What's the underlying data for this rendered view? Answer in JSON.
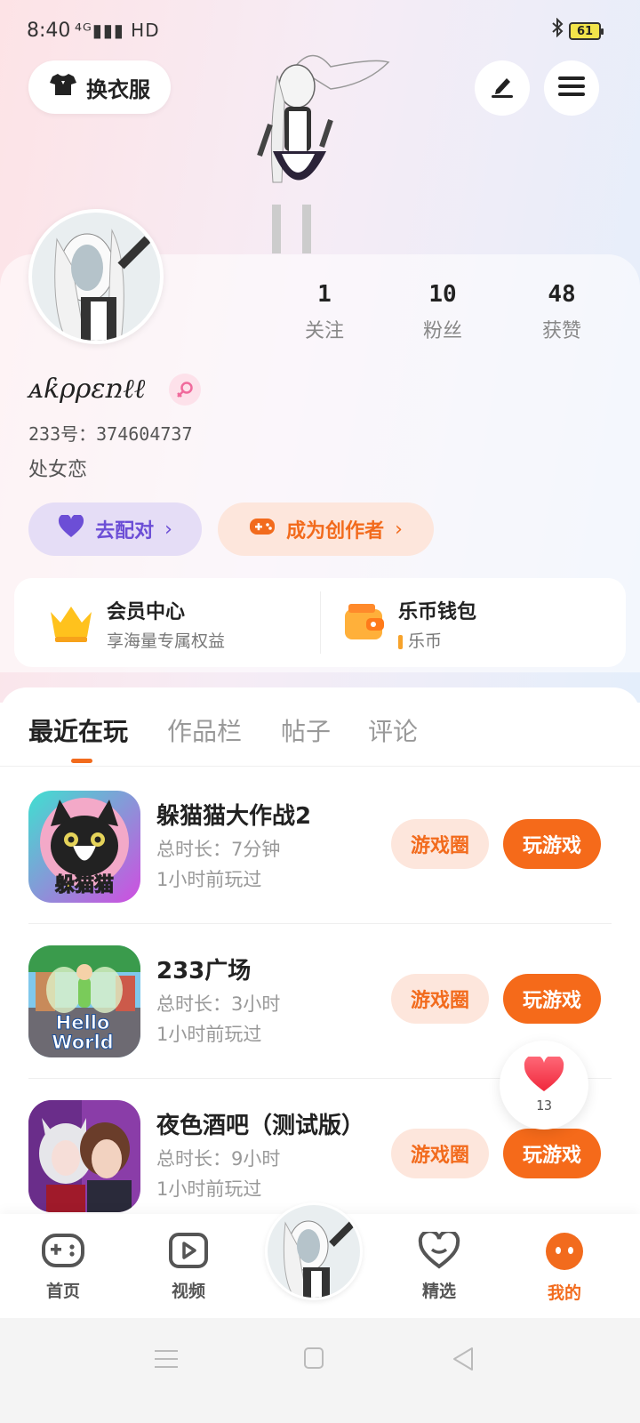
{
  "status_bar": {
    "time": "8:40",
    "network": "⁴ᴳ▮▮▮ HD",
    "battery": "61"
  },
  "header": {
    "outfit_label": "换衣服"
  },
  "profile": {
    "stats": [
      {
        "value": "1",
        "label": "关注"
      },
      {
        "value": "10",
        "label": "粉丝"
      },
      {
        "value": "48",
        "label": "获赞"
      }
    ],
    "nickname": "ᴀƙρρεռℓℓ",
    "user_id": "233号：374604737",
    "bio": "处女恋",
    "match_label": "去配对",
    "creator_label": "成为创作者"
  },
  "member": {
    "title": "会员中心",
    "subtitle": "享海量专属权益"
  },
  "wallet": {
    "title": "乐币钱包",
    "subtitle": "乐币"
  },
  "tabs": [
    {
      "label": "最近在玩"
    },
    {
      "label": "作品栏"
    },
    {
      "label": "帖子"
    },
    {
      "label": "评论"
    }
  ],
  "games": [
    {
      "title": "躲猫猫大作战2",
      "duration": "总时长：7分钟",
      "last_played": "1小时前玩过",
      "icon_text": "躲猫猫"
    },
    {
      "title": "233广场",
      "duration": "总时长：3小时",
      "last_played": "1小时前玩过",
      "icon_text": "Hello World"
    },
    {
      "title": "夜色酒吧（测试版）",
      "duration": "总时长：9小时",
      "last_played": "1小时前玩过",
      "icon_text": ""
    }
  ],
  "game_buttons": {
    "circle": "游戏圈",
    "play": "玩游戏"
  },
  "like_float": {
    "count": "13"
  },
  "bottom_nav": [
    {
      "label": "首页"
    },
    {
      "label": "视频"
    },
    {
      "label": "精选"
    },
    {
      "label": "我的"
    }
  ],
  "colors": {
    "accent": "#f26b1d",
    "purple": "#6c4ed6",
    "match_bg": "#e5ddf6",
    "creator_bg": "#fde6dc"
  }
}
